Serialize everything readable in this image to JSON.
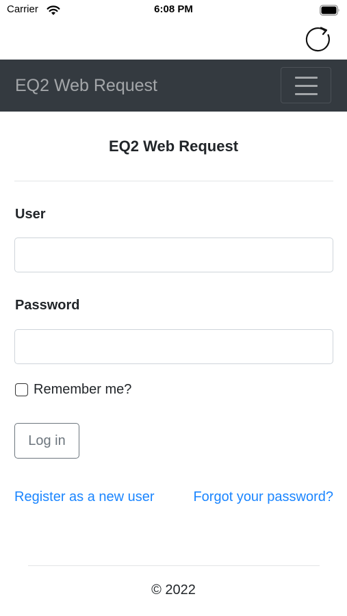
{
  "status_bar": {
    "carrier": "Carrier",
    "time": "6:08 PM",
    "wifi_icon": "wifi-icon",
    "battery_icon": "battery-full-icon"
  },
  "toolbar": {
    "reload_icon": "reload-icon"
  },
  "navbar": {
    "brand": "EQ2 Web Request",
    "toggler_icon": "hamburger-menu-icon",
    "background": "#343a40"
  },
  "page": {
    "heading": "EQ2 Web Request"
  },
  "form": {
    "user_label": "User",
    "user_value": "",
    "password_label": "Password",
    "password_value": "",
    "remember_label": "Remember me?",
    "remember_checked": false,
    "login_label": "Log in"
  },
  "links": {
    "register": "Register as a new user",
    "forgot": "Forgot your password?",
    "color": "#1a85ff"
  },
  "footer": {
    "copyright": "© 2022"
  }
}
